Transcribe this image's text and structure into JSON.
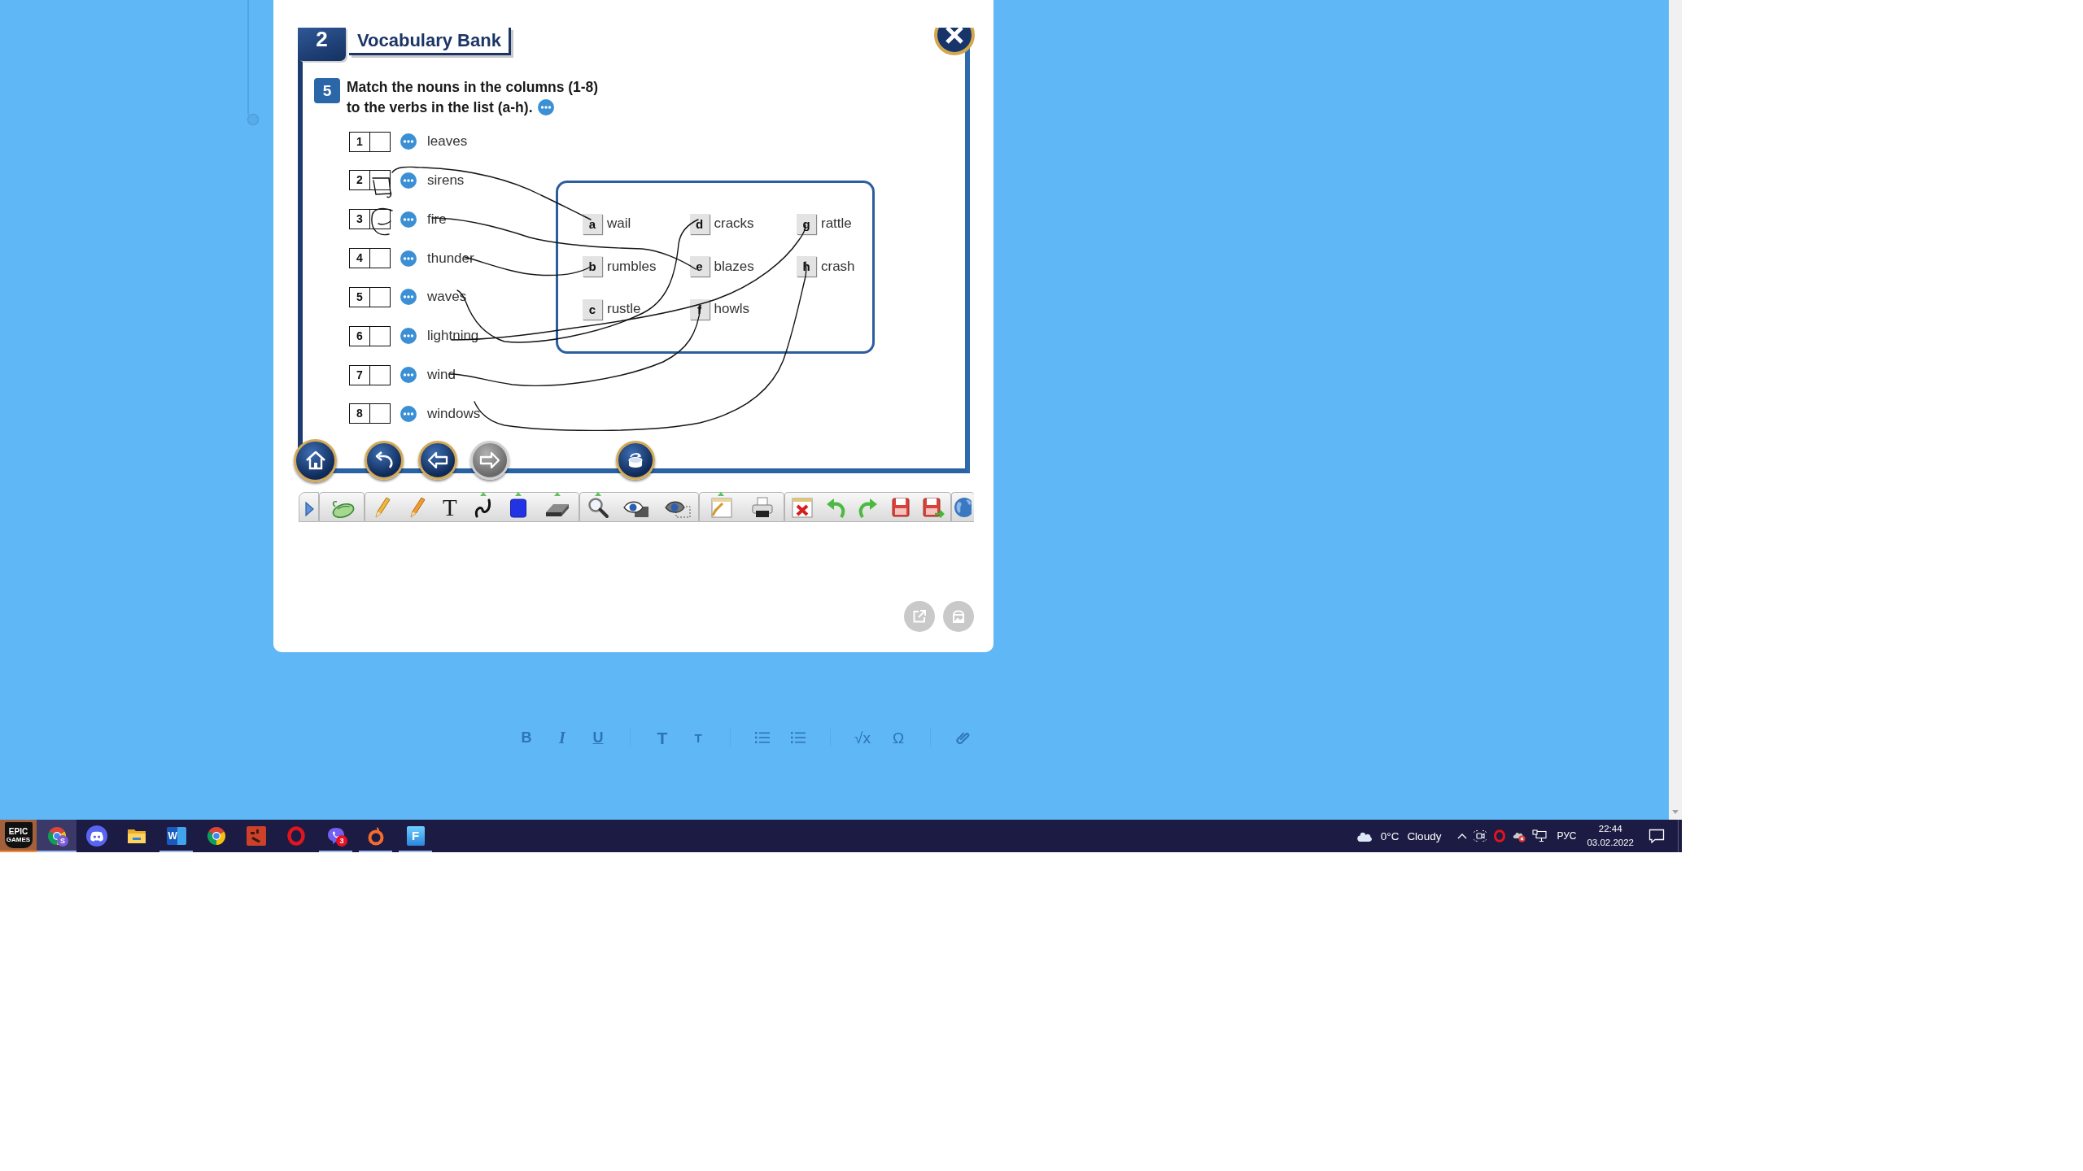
{
  "editor_toolbar": {
    "groups": [
      {
        "items": [
          {
            "kind": "bold",
            "label": "B"
          },
          {
            "kind": "italic",
            "label": "I"
          },
          {
            "kind": "underline",
            "label": "U"
          }
        ]
      },
      {
        "items": [
          {
            "kind": "large",
            "label": "T"
          },
          {
            "kind": "small",
            "label": "T"
          }
        ]
      },
      {
        "items": [
          {
            "kind": "list"
          },
          {
            "kind": "list"
          }
        ]
      },
      {
        "items": [
          {
            "kind": "symbol",
            "label": "√x"
          },
          {
            "kind": "symbol",
            "label": "Ω"
          }
        ]
      },
      {
        "items": [
          {
            "kind": "link"
          }
        ]
      }
    ]
  },
  "exercise": {
    "unit": {
      "number": "2",
      "title": "Vocabulary Bank"
    },
    "task": {
      "number": "5",
      "lines": [
        "Match the nouns in the columns (1-8)",
        "to the verbs in the list (a-h)."
      ]
    },
    "nouns": [
      {
        "number": "1",
        "word": "leaves"
      },
      {
        "number": "2",
        "word": "sirens"
      },
      {
        "number": "3",
        "word": "fire"
      },
      {
        "number": "4",
        "word": "thunder"
      },
      {
        "number": "5",
        "word": "waves"
      },
      {
        "number": "6",
        "word": "lightning"
      },
      {
        "number": "7",
        "word": "wind"
      },
      {
        "number": "8",
        "word": "windows"
      }
    ],
    "verbs": [
      {
        "letter": "a",
        "word": "wail"
      },
      {
        "letter": "b",
        "word": "rumbles"
      },
      {
        "letter": "c",
        "word": "rustle"
      },
      {
        "letter": "d",
        "word": "cracks"
      },
      {
        "letter": "e",
        "word": "blazes"
      },
      {
        "letter": "f",
        "word": "howls"
      },
      {
        "letter": "g",
        "word": "rattle"
      },
      {
        "letter": "h",
        "word": "crash"
      }
    ],
    "nav_buttons": [
      {
        "kind": "home",
        "disabled": false
      },
      {
        "kind": "back",
        "disabled": false
      },
      {
        "kind": "previous",
        "disabled": false
      },
      {
        "kind": "next",
        "disabled": true
      },
      {
        "kind": "reset",
        "disabled": false
      }
    ]
  },
  "toolbar": {
    "groups": [
      {
        "tools": [
          {
            "kind": "expand",
            "menu": false
          }
        ]
      },
      {
        "tools": [
          {
            "kind": "pointer",
            "menu": false
          }
        ]
      },
      {
        "tools": [
          {
            "kind": "pencil",
            "menu": false
          },
          {
            "kind": "highlighter",
            "menu": false
          },
          {
            "kind": "text",
            "label": "T",
            "menu": false
          },
          {
            "kind": "curve",
            "menu": true
          },
          {
            "kind": "shape",
            "menu": true
          },
          {
            "kind": "eraser",
            "menu": true
          }
        ]
      },
      {
        "tools": [
          {
            "kind": "magnifier",
            "menu": true
          },
          {
            "kind": "spotlight",
            "menu": false
          },
          {
            "kind": "reveal",
            "menu": false
          }
        ]
      },
      {
        "tools": [
          {
            "kind": "note",
            "menu": true
          },
          {
            "kind": "print",
            "menu": false
          }
        ]
      },
      {
        "tools": [
          {
            "kind": "clear",
            "menu": false
          },
          {
            "kind": "undo",
            "menu": false
          },
          {
            "kind": "redo",
            "menu": false
          },
          {
            "kind": "save",
            "menu": false
          },
          {
            "kind": "save-as",
            "menu": false
          }
        ]
      },
      {
        "tools": [
          {
            "kind": "web",
            "menu": false
          }
        ]
      }
    ]
  },
  "taskbar": {
    "apps": [
      {
        "kind": "shield",
        "logo_text": [
          "EPIC",
          "GAMES"
        ],
        "active": false,
        "flashing": true,
        "running": false
      },
      {
        "kind": "browser",
        "badge": "S",
        "active": true,
        "flashing": false,
        "running": true
      },
      {
        "kind": "chat",
        "active": false,
        "flashing": false,
        "running": false
      },
      {
        "kind": "folder",
        "active": false,
        "flashing": false,
        "running": false
      },
      {
        "kind": "document",
        "logo_text": [
          "W"
        ],
        "active": false,
        "flashing": false,
        "running": true
      },
      {
        "kind": "browser",
        "active": false,
        "flashing": false,
        "running": false
      },
      {
        "kind": "square",
        "active": false,
        "flashing": false,
        "running": false
      },
      {
        "kind": "ring",
        "active": false,
        "flashing": false,
        "running": false
      },
      {
        "kind": "messenger",
        "badge": "3",
        "active": false,
        "flashing": false,
        "running": true
      },
      {
        "kind": "flame-ring",
        "active": false,
        "flashing": false,
        "running": true
      },
      {
        "kind": "letter-tile",
        "logo_text": [
          "F"
        ],
        "active": false,
        "flashing": false,
        "running": true
      }
    ],
    "weather": {
      "temperature": "0°C",
      "condition": "Cloudy"
    },
    "language": "РУС",
    "time": "22:44",
    "date": "03.02.2022"
  }
}
